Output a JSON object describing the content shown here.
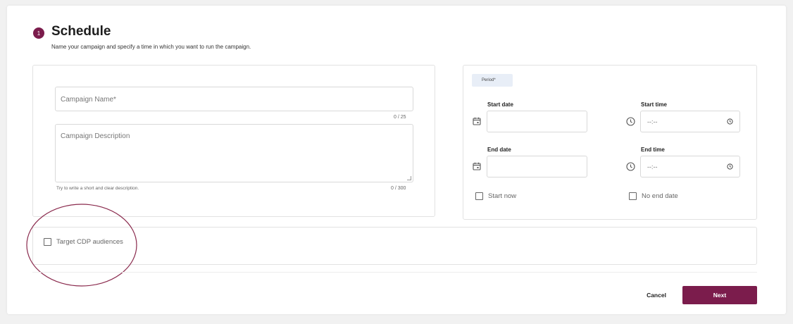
{
  "header": {
    "step_number": "1",
    "title": "Schedule",
    "subtitle": "Name your campaign and specify a time in which you want to run the campaign."
  },
  "campaign": {
    "name_placeholder": "Campaign Name*",
    "name_counter": "0 / 25",
    "description_placeholder": "Campaign Description",
    "description_counter": "0 / 300",
    "description_hint": "Try to write a short and clear description."
  },
  "period": {
    "chip_label": "Period*",
    "start_date_label": "Start date",
    "start_time_label": "Start time",
    "end_date_label": "End date",
    "end_time_label": "End time",
    "start_time_value": "--:--",
    "end_time_value": "--:--",
    "start_now_label": "Start now",
    "no_end_date_label": "No end date"
  },
  "audiences": {
    "target_cdp_label": "Target CDP audiences"
  },
  "footer": {
    "cancel_label": "Cancel",
    "next_label": "Next"
  },
  "colors": {
    "accent": "#7b1c4c",
    "period_chip_bg": "#e8eef7"
  }
}
